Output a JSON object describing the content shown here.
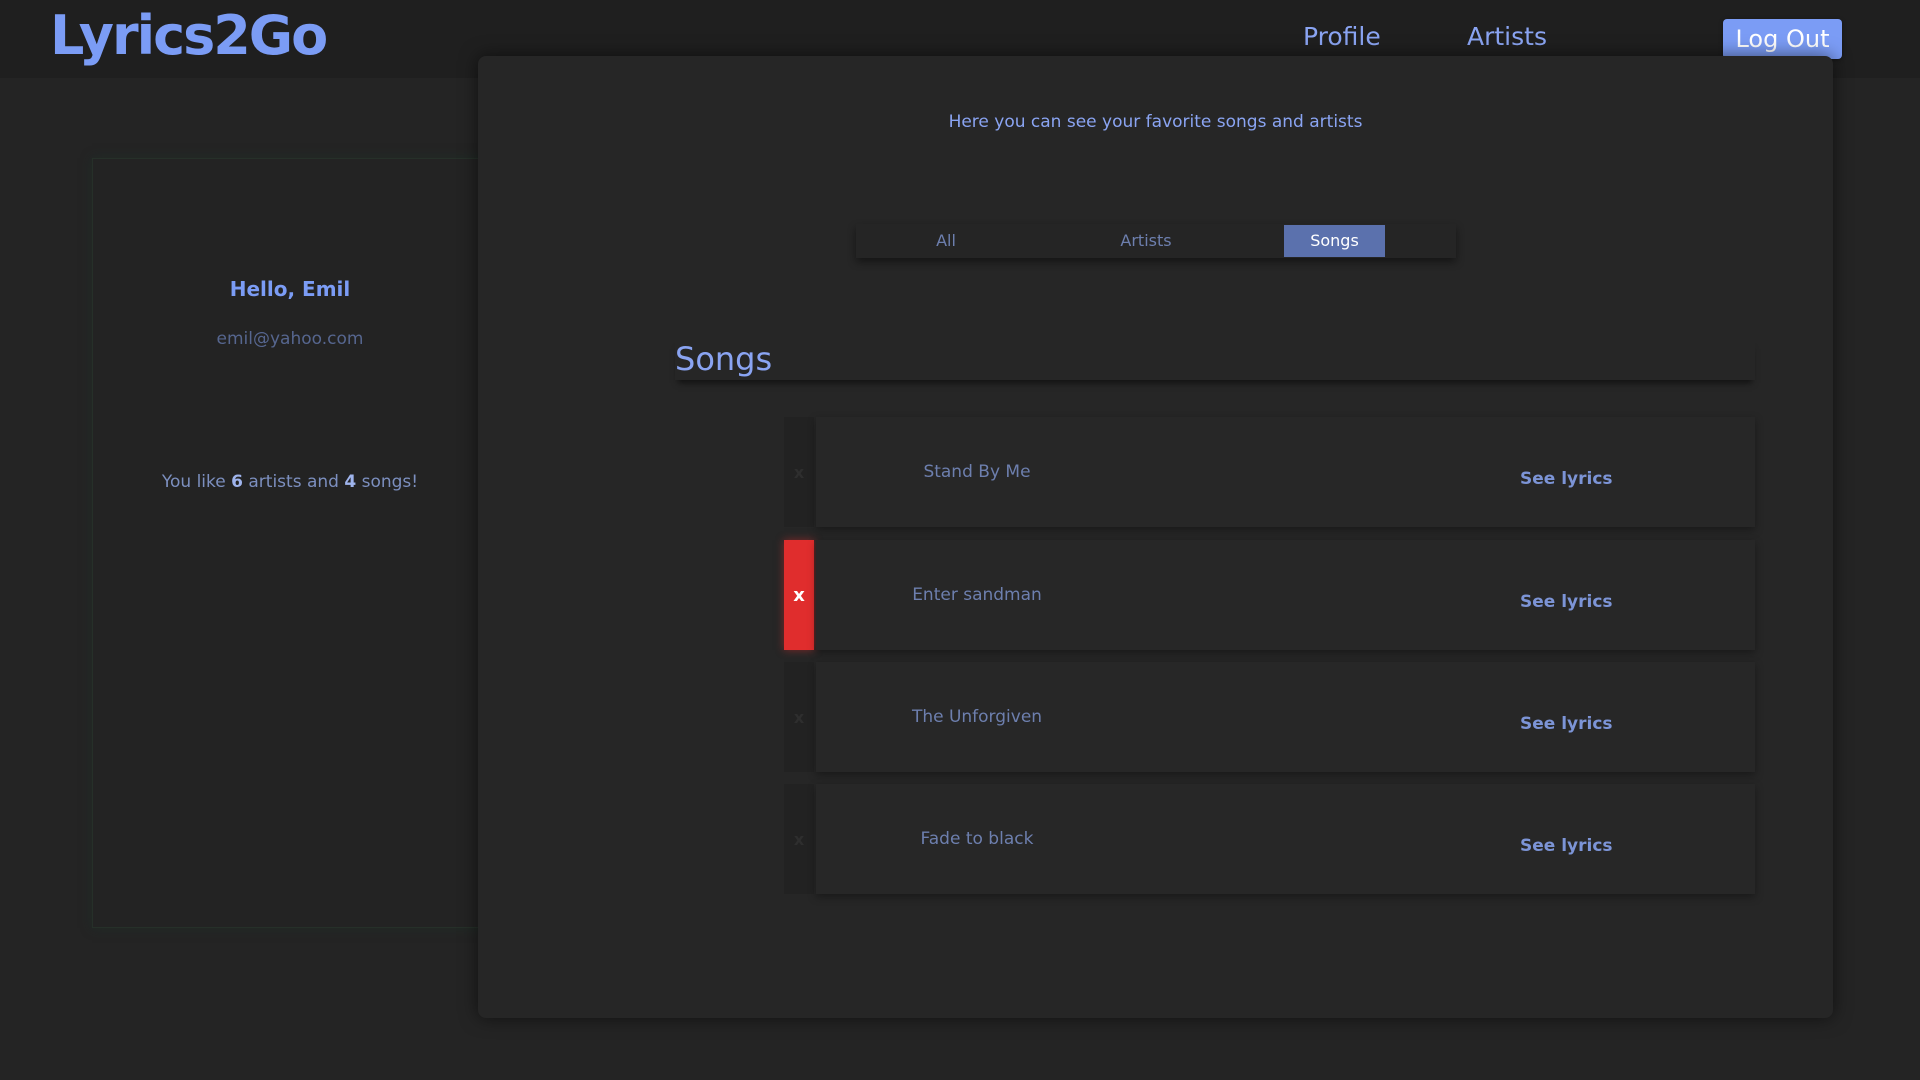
{
  "header": {
    "logo": "Lyrics2Go",
    "nav": {
      "profile": "Profile",
      "artists": "Artists"
    },
    "logout_label": "Log Out"
  },
  "profile": {
    "greeting": "Hello, Emil",
    "email": "emil@yahoo.com",
    "likes_prefix": "You like ",
    "artists_count": "6",
    "likes_middle": " artists and ",
    "songs_count": "4",
    "likes_suffix": " songs!"
  },
  "main": {
    "subtitle": "Here you can see your favorite songs and artists",
    "tabs": {
      "all": "All",
      "artists": "Artists",
      "songs": "Songs"
    },
    "active_tab": "Songs",
    "section_title": "Songs",
    "delete_label": "x",
    "songs": [
      {
        "name": "Stand By Me",
        "link": "See lyrics"
      },
      {
        "name": "Enter sandman",
        "link": "See lyrics"
      },
      {
        "name": "The Unforgiven",
        "link": "See lyrics"
      },
      {
        "name": "Fade to black",
        "link": "See lyrics"
      }
    ]
  },
  "colors": {
    "accent": "#7b9cf5",
    "active_tab": "#5b71ad",
    "delete_hover": "#e02d2d",
    "background": "#242424"
  }
}
